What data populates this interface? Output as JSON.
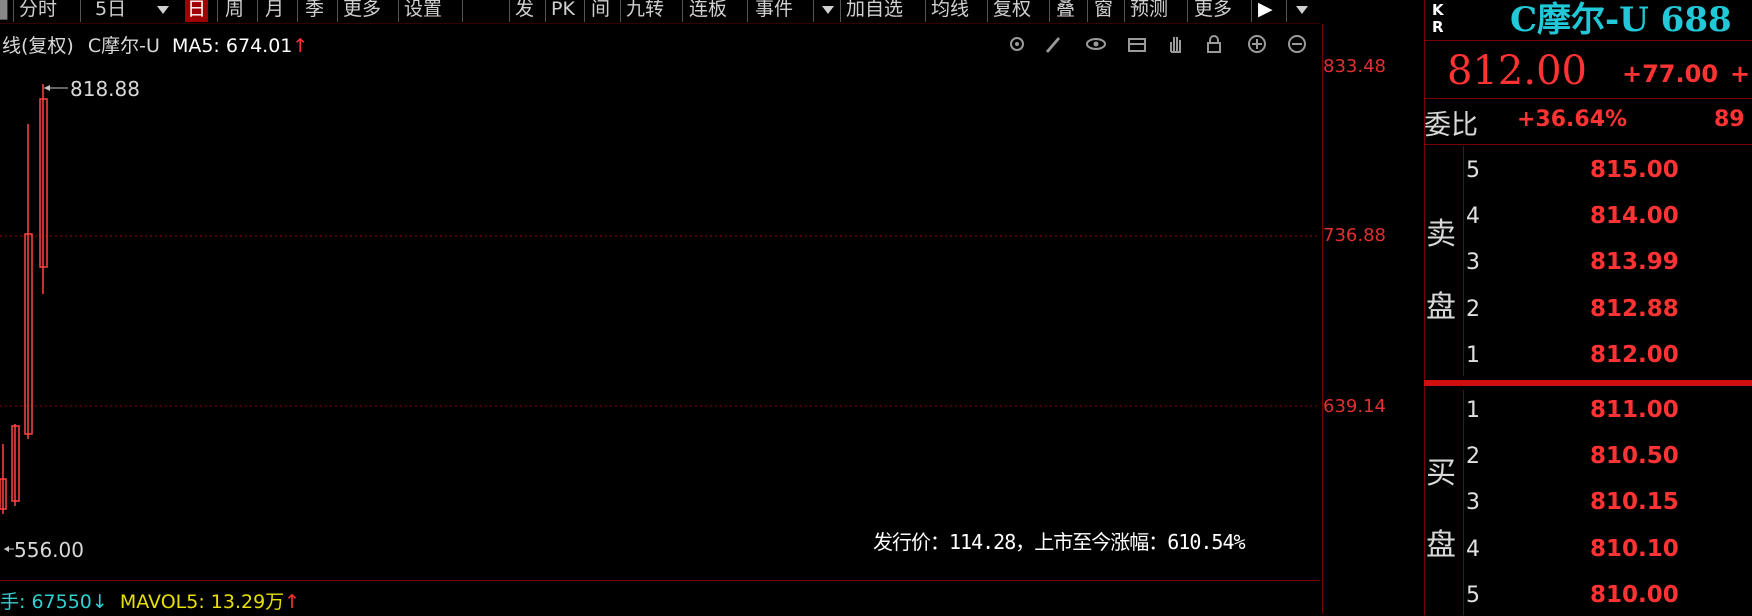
{
  "toolbar": {
    "items": [
      {
        "label": "分时"
      },
      {
        "label": "5日"
      },
      {
        "label": "日"
      },
      {
        "label": "周"
      },
      {
        "label": "月"
      },
      {
        "label": "季"
      },
      {
        "label": "更多"
      },
      {
        "label": "设置"
      },
      {
        "label": "发"
      },
      {
        "label": "PK"
      },
      {
        "label": "间"
      },
      {
        "label": "九转"
      },
      {
        "label": "连板"
      },
      {
        "label": "事件"
      },
      {
        "label": "加自选"
      },
      {
        "label": "均线"
      },
      {
        "label": "复权"
      },
      {
        "label": "叠"
      },
      {
        "label": "窗"
      },
      {
        "label": "预测"
      },
      {
        "label": "更多"
      }
    ],
    "active_item": "日"
  },
  "chart": {
    "title_prefix": "线(复权)",
    "stock": "C摩尔-U",
    "ma_label": "MA5:",
    "ma_value": "674.01",
    "ma_arrow": "↑",
    "tools": [
      "settings-icon",
      "draw-icon",
      "eye-icon",
      "layers-icon",
      "hand-icon",
      "lock-icon",
      "zoom-in-icon",
      "zoom-out-icon"
    ],
    "high_marker": "818.88",
    "low_marker": "556.00",
    "ipo_text": "发行价：114.28，上市至今涨幅：610.54%"
  },
  "price_axis": {
    "labels": [
      "833.48",
      "736.88",
      "639.14"
    ]
  },
  "volume": {
    "label1": "手: 67550",
    "arrow1": "↓",
    "label2": "MAVOL5: 13.29万",
    "arrow2": "↑"
  },
  "quote": {
    "kr_top": "K",
    "kr_bottom": "R",
    "stock_name": "C摩尔-U 688",
    "last_price": "812.00",
    "change": "+77.00",
    "change2": "+",
    "weibi_label": "委比",
    "weibi_value": "+36.64%",
    "weibi_diff": "89",
    "sell_label_1": "卖",
    "sell_label_2": "盘",
    "buy_label_1": "买",
    "buy_label_2": "盘",
    "sell": [
      {
        "level": "5",
        "price": "815.00"
      },
      {
        "level": "4",
        "price": "814.00"
      },
      {
        "level": "3",
        "price": "813.99"
      },
      {
        "level": "2",
        "price": "812.88"
      },
      {
        "level": "1",
        "price": "812.00"
      }
    ],
    "buy": [
      {
        "level": "1",
        "price": "811.00"
      },
      {
        "level": "2",
        "price": "810.50"
      },
      {
        "level": "3",
        "price": "810.15"
      },
      {
        "level": "4",
        "price": "810.10"
      },
      {
        "level": "5",
        "price": "810.00"
      }
    ]
  },
  "colors": {
    "up": "#ff3333",
    "accent": "#20c8d8",
    "axis": "#7a0000"
  }
}
